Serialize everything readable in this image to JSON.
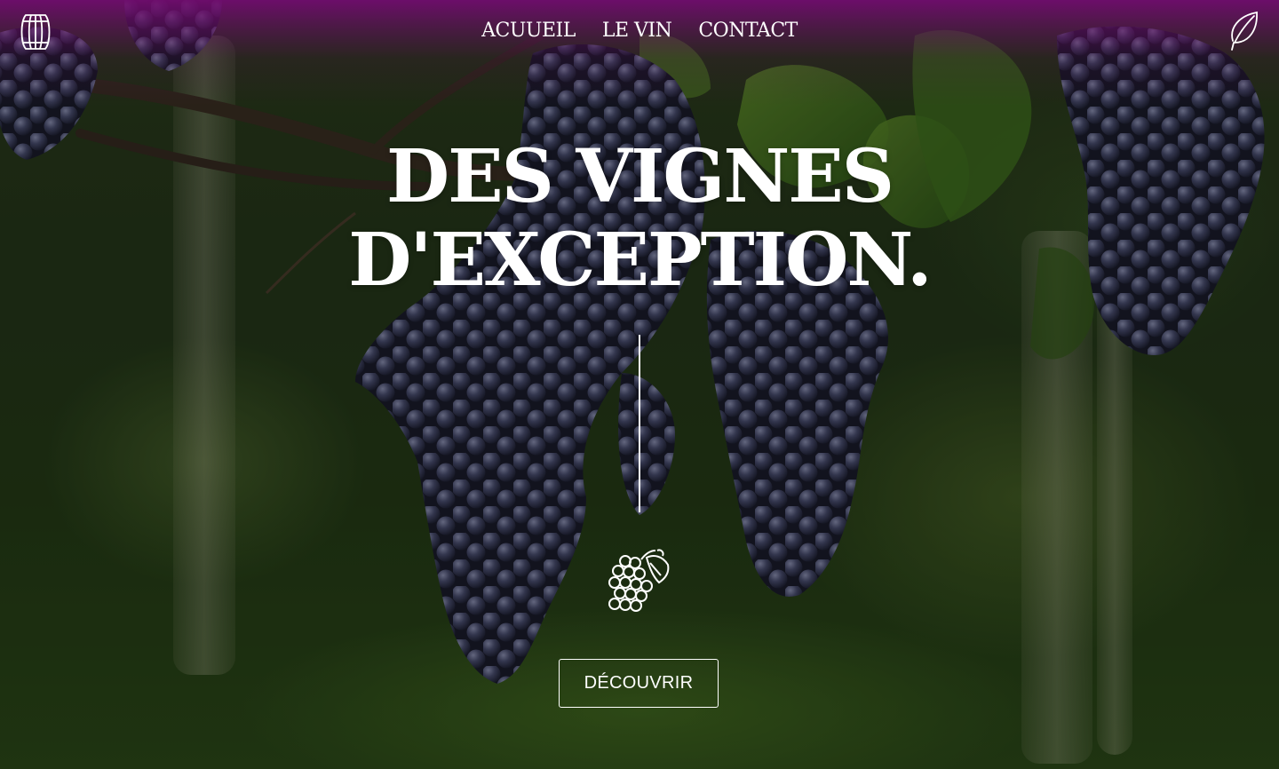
{
  "nav": {
    "links": [
      {
        "label": "ACUUEIL"
      },
      {
        "label": "LE VIN"
      },
      {
        "label": "CONTACT"
      }
    ],
    "logo_icon": "wine-barrel-icon",
    "right_icon": "leaf-icon"
  },
  "hero": {
    "title_line1": "DES VIGNES",
    "title_line2": "D'EXCEPTION.",
    "center_icon": "grapes-icon",
    "cta_label": "DÉCOUVRIR"
  },
  "colors": {
    "top_band": "#700c6e",
    "text": "#ffffff",
    "grape": "#3a3e5e",
    "foliage": "#2e4a1a"
  }
}
